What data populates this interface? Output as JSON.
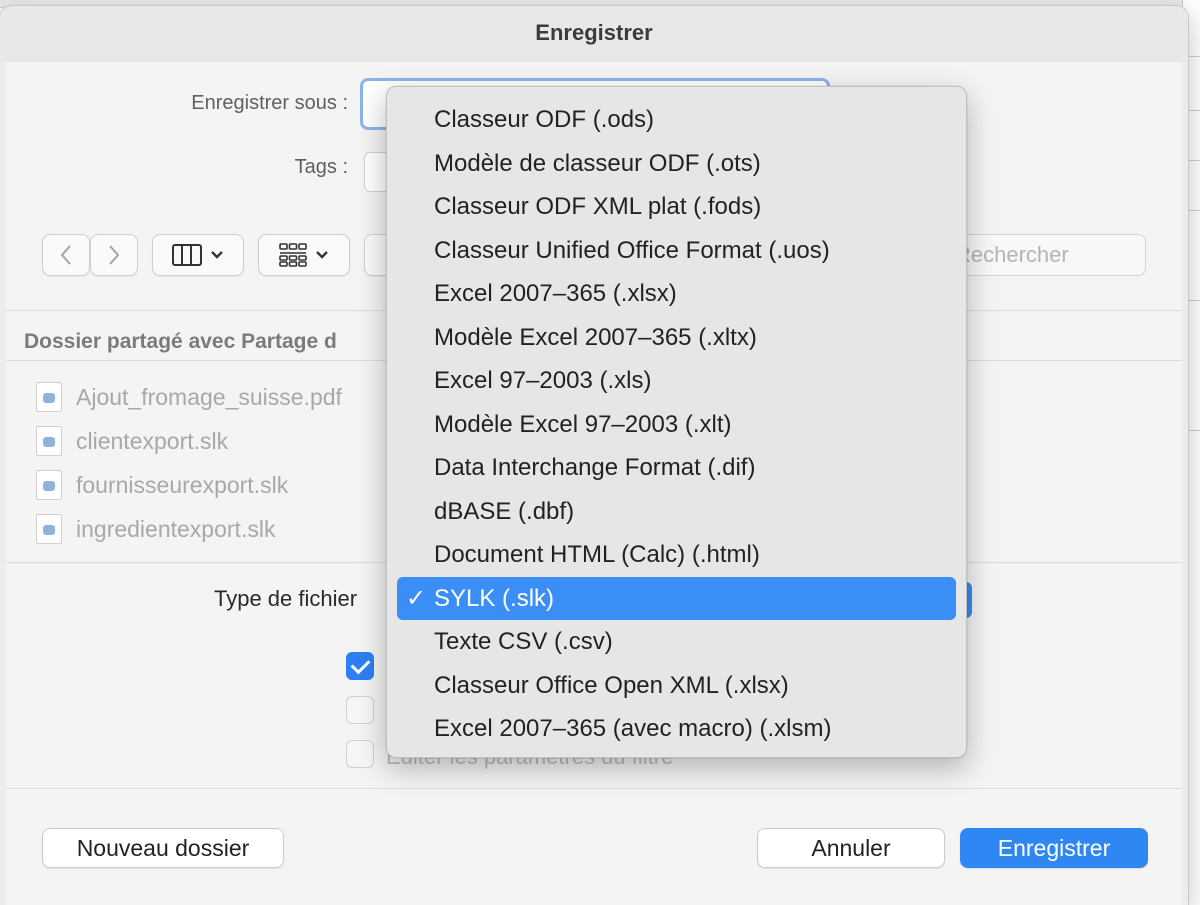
{
  "dialog": {
    "title": "Enregistrer",
    "save_as_label": "Enregistrer sous :",
    "save_as_value": "",
    "tags_label": "Tags :",
    "search_placeholder": "Rechercher",
    "folder_label": "Dossier partagé avec Partage d",
    "files": [
      {
        "name": "Ajout_fromage_suisse.pdf",
        "icon": "pdf-file-icon"
      },
      {
        "name": "clientexport.slk",
        "icon": "slk-file-icon"
      },
      {
        "name": "fournisseurexport.slk",
        "icon": "slk-file-icon"
      },
      {
        "name": "ingredientexport.slk",
        "icon": "slk-file-icon"
      }
    ],
    "file_type_label": "Type de fichier",
    "options_hint": "Éditer les paramètres du filtre",
    "new_folder_button": "Nouveau dossier",
    "cancel_button": "Annuler",
    "save_button": "Enregistrer"
  },
  "file_type_menu": {
    "selected_index": 11,
    "check_mark": "✓",
    "items": [
      "Classeur ODF (.ods)",
      "Modèle de classeur ODF (.ots)",
      "Classeur ODF XML plat (.fods)",
      "Classeur Unified Office Format (.uos)",
      "Excel 2007–365 (.xlsx)",
      "Modèle Excel 2007–365 (.xltx)",
      "Excel 97–2003 (.xls)",
      "Modèle Excel 97–2003 (.xlt)",
      "Data Interchange Format (.dif)",
      "dBASE (.dbf)",
      "Document HTML (Calc) (.html)",
      "SYLK (.slk)",
      "Texte CSV (.csv)",
      "Classeur Office Open XML (.xlsx)",
      "Excel 2007–365 (avec macro) (.xlsm)"
    ]
  },
  "colors": {
    "accent": "#2f87f4",
    "selected_item": "#3b8ef6"
  }
}
